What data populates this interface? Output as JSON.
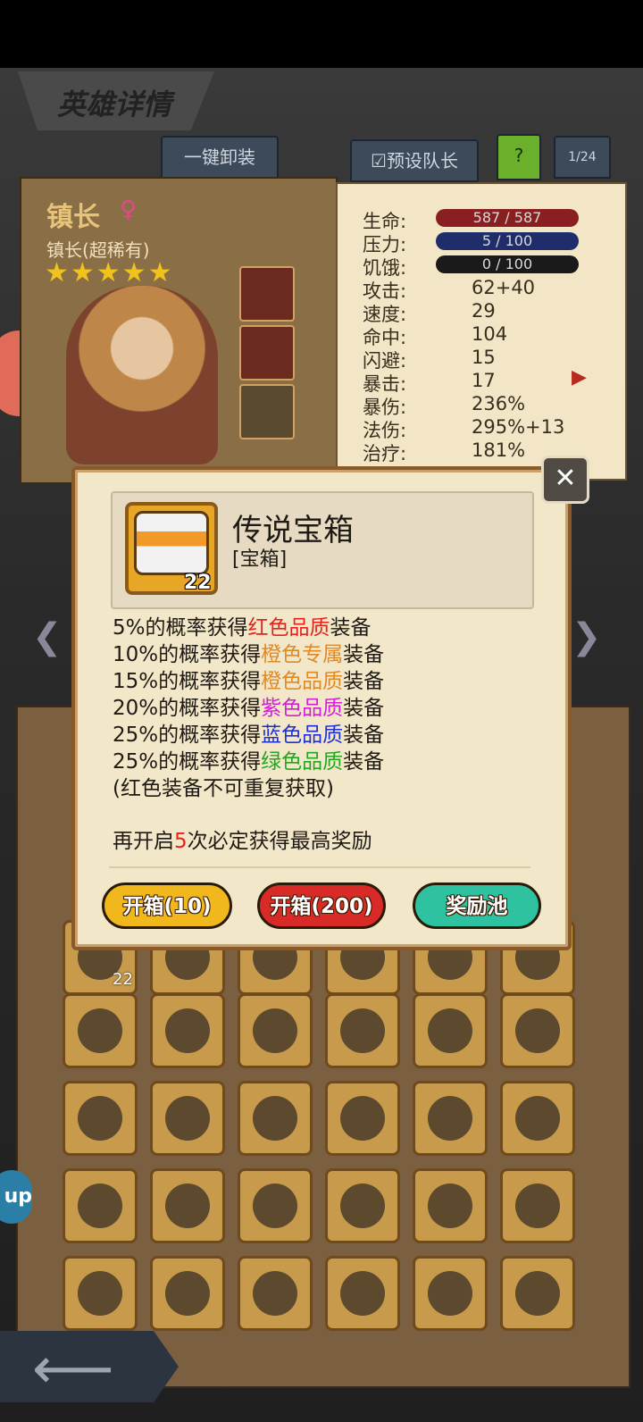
{
  "header": {
    "title": "英雄详情"
  },
  "tabs": {
    "unequip_all": "一键卸装",
    "preset_leader": "预设队长",
    "help": "?",
    "page": "1/24"
  },
  "hero": {
    "name": "镇长",
    "subtitle": "镇长(超稀有)",
    "stars": 5,
    "star_glyph": "★★★★★"
  },
  "stats": {
    "hp": {
      "label": "生命:",
      "value": "587 / 587",
      "color": "#8a1f22"
    },
    "stress": {
      "label": "压力:",
      "value": "5 / 100",
      "color": "#1f2e6a"
    },
    "hunger": {
      "label": "饥饿:",
      "value": "0 / 100",
      "color": "#1a1a1a"
    },
    "rows": [
      {
        "label": "攻击:",
        "value": "62+40"
      },
      {
        "label": "速度:",
        "value": "29"
      },
      {
        "label": "命中:",
        "value": "104"
      },
      {
        "label": "闪避:",
        "value": "15"
      },
      {
        "label": "暴击:",
        "value": "17"
      },
      {
        "label": "暴伤:",
        "value": "236%"
      },
      {
        "label": "法伤:",
        "value": "295%+13"
      },
      {
        "label": "治疗:",
        "value": "181%"
      }
    ]
  },
  "inventory": {
    "first_slot_count": "22"
  },
  "modal": {
    "item_name": "传说宝箱",
    "item_type": "[宝箱]",
    "item_count": "22",
    "odds": [
      {
        "prefix": "5%的概率获得",
        "quality": "红色品质",
        "suffix": "装备",
        "color": "#e3231c"
      },
      {
        "prefix": "10%的概率获得",
        "quality": "橙色专属",
        "suffix": "装备",
        "color": "#e08a25"
      },
      {
        "prefix": "15%的概率获得",
        "quality": "橙色品质",
        "suffix": "装备",
        "color": "#e08a25"
      },
      {
        "prefix": "20%的概率获得",
        "quality": "紫色品质",
        "suffix": "装备",
        "color": "#d21fd4"
      },
      {
        "prefix": "25%的概率获得",
        "quality": "蓝色品质",
        "suffix": "装备",
        "color": "#1e2fd6"
      },
      {
        "prefix": "25%的概率获得",
        "quality": "绿色品质",
        "suffix": "装备",
        "color": "#21a81e"
      }
    ],
    "note": "(红色装备不可重复获取)",
    "pity": {
      "prefix": "再开启",
      "count": "5",
      "suffix": "次必定获得最高奖励",
      "count_color": "#e3231c"
    },
    "buttons": {
      "open_10": "开箱(10)",
      "open_200": "开箱(200)",
      "reward_pool": "奖励池"
    }
  }
}
